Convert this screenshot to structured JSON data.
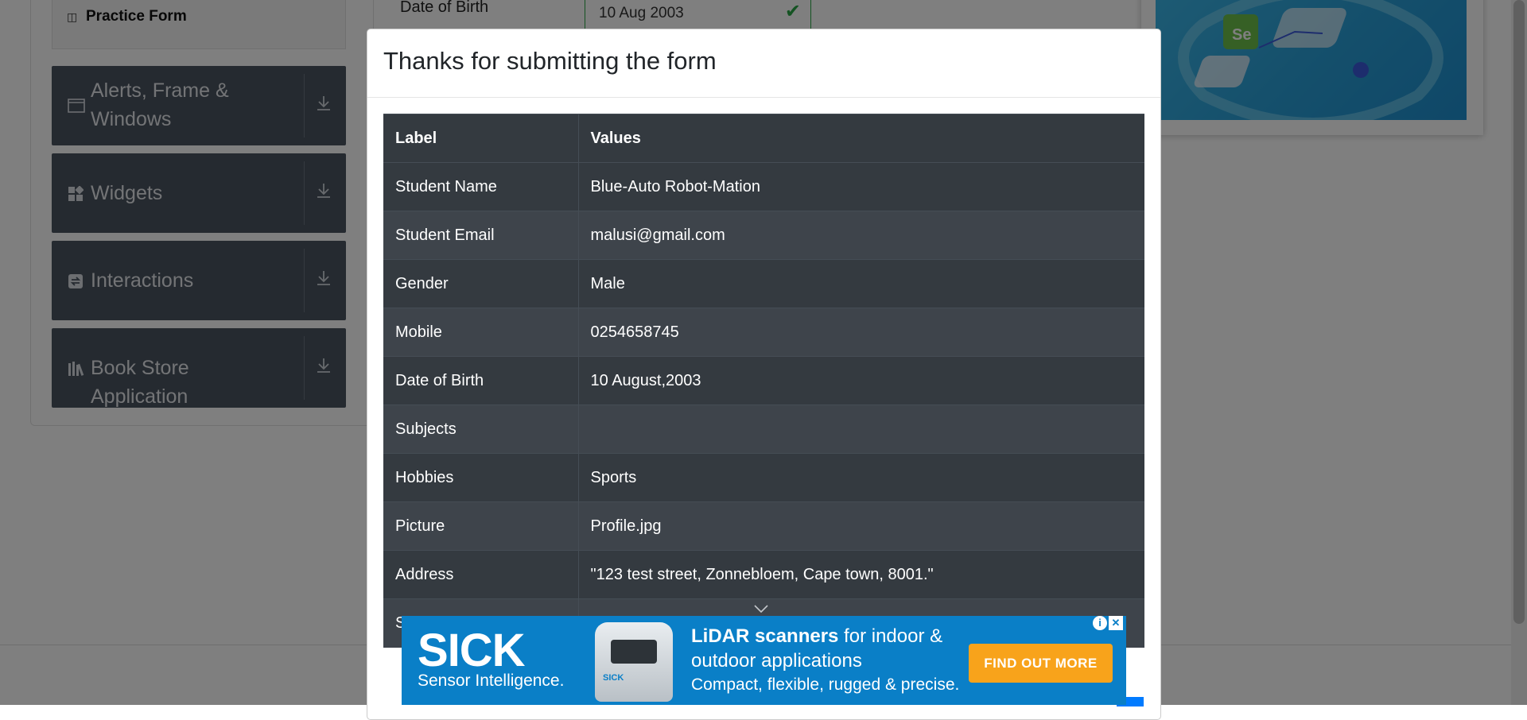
{
  "sidebar": {
    "practice_form": "Practice Form",
    "groups": [
      {
        "label": "Alerts, Frame & Windows",
        "icon": "window-icon"
      },
      {
        "label": "Widgets",
        "icon": "widgets-icon"
      },
      {
        "label": "Interactions",
        "icon": "interactions-icon"
      },
      {
        "label": "Book Store Application",
        "icon": "books-icon"
      }
    ]
  },
  "form_bg": {
    "dob_label": "Date of Birth",
    "dob_value": "10 Aug 2003"
  },
  "modal": {
    "title": "Thanks for submitting the form",
    "headers": {
      "label": "Label",
      "values": "Values"
    },
    "rows": [
      {
        "label": "Student Name",
        "value": "Blue-Auto Robot-Mation"
      },
      {
        "label": "Student Email",
        "value": "malusi@gmail.com"
      },
      {
        "label": "Gender",
        "value": "Male"
      },
      {
        "label": "Mobile",
        "value": "0254658745"
      },
      {
        "label": "Date of Birth",
        "value": "10 August,2003"
      },
      {
        "label": "Subjects",
        "value": ""
      },
      {
        "label": "Hobbies",
        "value": "Sports"
      },
      {
        "label": "Picture",
        "value": "Profile.jpg"
      },
      {
        "label": "Address",
        "value": "\"123 test street, Zonnebloem, Cape town, 8001.\""
      },
      {
        "label": "S",
        "value": ""
      }
    ]
  },
  "ad": {
    "brand": "SICK",
    "tagline": "Sensor Intelligence.",
    "headline_bold": "LiDAR scanners",
    "headline_rest": " for indoor & outdoor applications",
    "subline": "Compact, flexible, rugged & precise.",
    "cta": "FIND OUT MORE",
    "product_logo": "SICK",
    "info": "i",
    "close": "✕"
  },
  "colors": {
    "table_dark": "#343a40",
    "table_stripe": "#3e444b",
    "ad_blue": "#0a7fc7",
    "ad_cta": "#f8a31b",
    "valid_green": "#28a745"
  }
}
